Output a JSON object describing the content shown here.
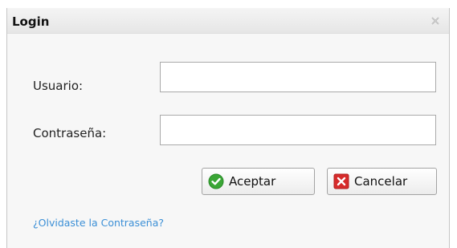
{
  "dialog": {
    "title": "Login",
    "close_icon": "close-icon"
  },
  "form": {
    "username_label": "Usuario:",
    "username_value": "",
    "password_label": "Contraseña:",
    "password_value": ""
  },
  "buttons": {
    "accept_label": "Aceptar",
    "accept_icon": "check-circle-icon",
    "cancel_label": "Cancelar",
    "cancel_icon": "x-square-icon"
  },
  "links": {
    "forgot_password": "¿Olvidaste la Contraseña?"
  },
  "colors": {
    "link": "#3b8fd6",
    "accept_icon": "#3aa636",
    "cancel_icon": "#d62b2b"
  }
}
